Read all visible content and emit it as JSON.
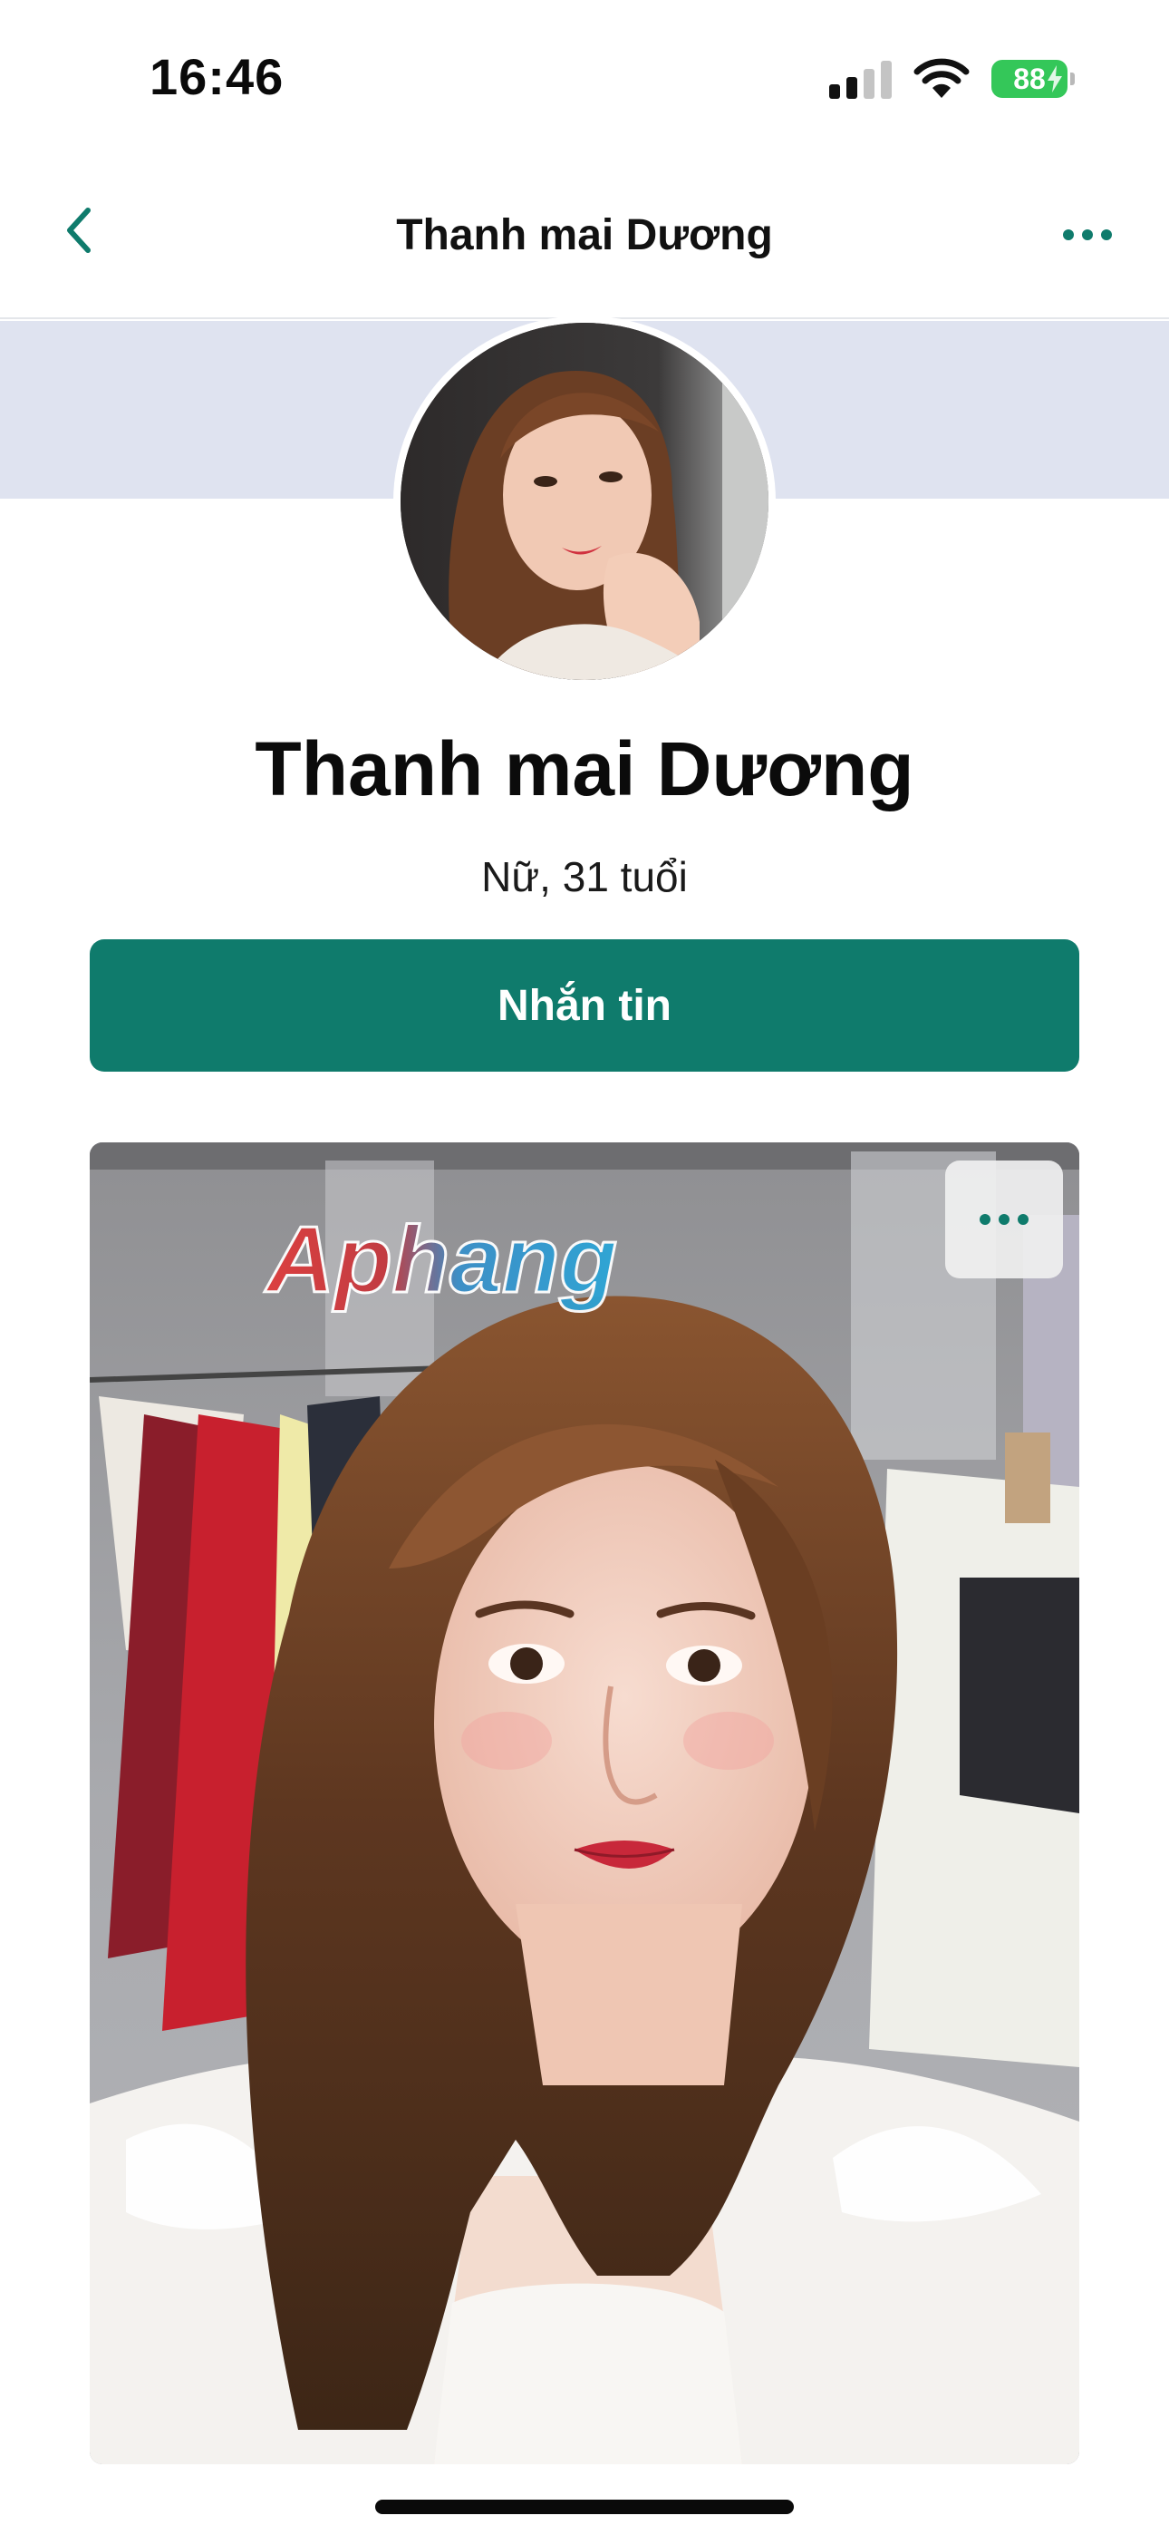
{
  "status": {
    "time": "16:46",
    "battery": "88"
  },
  "nav": {
    "title": "Thanh mai Dương",
    "back_icon": "chevron-left-icon",
    "more_icon": "more-horizontal-icon"
  },
  "profile": {
    "name": "Thanh mai Dương",
    "meta": "Nữ, 31 tuổi",
    "message_button": "Nhắn tin"
  },
  "post": {
    "watermark": "Aphang",
    "more_icon": "more-horizontal-icon"
  },
  "colors": {
    "accent": "#0f7b6c",
    "cover": "#dfe3f0",
    "battery": "#34c759"
  }
}
